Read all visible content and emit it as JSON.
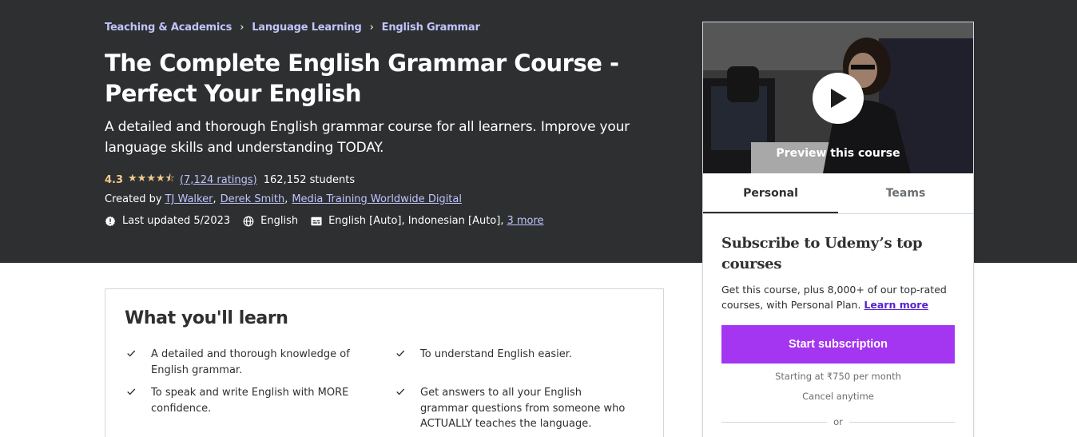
{
  "breadcrumb": [
    "Teaching & Academics",
    "Language Learning",
    "English Grammar"
  ],
  "course": {
    "title": "The Complete English Grammar Course - Perfect Your English",
    "subtitle": "A detailed and thorough English grammar course for all learners. Improve your language skills and understanding TODAY.",
    "rating": "4.3",
    "stars": "★★★★⯪",
    "ratings_count": "(7,124 ratings)",
    "students": "162,152 students",
    "created_by_label": "Created by",
    "instructors": [
      "TJ Walker",
      "Derek Smith",
      "Media Training Worldwide Digital"
    ],
    "last_updated": "Last updated 5/2023",
    "language": "English",
    "captions": "English [Auto], Indonesian [Auto],",
    "captions_more": "3 more"
  },
  "sidebar": {
    "preview_label": "Preview this course",
    "tabs": [
      {
        "label": "Personal",
        "active": true
      },
      {
        "label": "Teams",
        "active": false
      }
    ],
    "subscribe_title": "Subscribe to Udemy’s top courses",
    "subscribe_desc": "Get this course, plus 8,000+ of our top-rated courses, with Personal Plan.",
    "learn_more": "Learn more",
    "start_button": "Start subscription",
    "price_note": "Starting at ₹750 per month",
    "cancel_note": "Cancel anytime",
    "or_label": "or"
  },
  "learn": {
    "title": "What you'll learn",
    "items": [
      "A detailed and thorough knowledge of English grammar.",
      "To understand English easier.",
      "To speak and write English with MORE confidence.",
      "Get answers to all your English grammar questions from someone who ACTUALLY teaches the language."
    ]
  },
  "colors": {
    "hero_bg": "#2d2f31",
    "link_purple": "#c0c4fc",
    "star_gold": "#f3ca8c",
    "cta_purple": "#a435f0",
    "learn_more_purple": "#5624d0"
  },
  "icons": [
    "chevron-right-icon",
    "star-icon",
    "alert-badge-icon",
    "globe-icon",
    "closed-captions-icon",
    "play-icon",
    "check-icon"
  ]
}
